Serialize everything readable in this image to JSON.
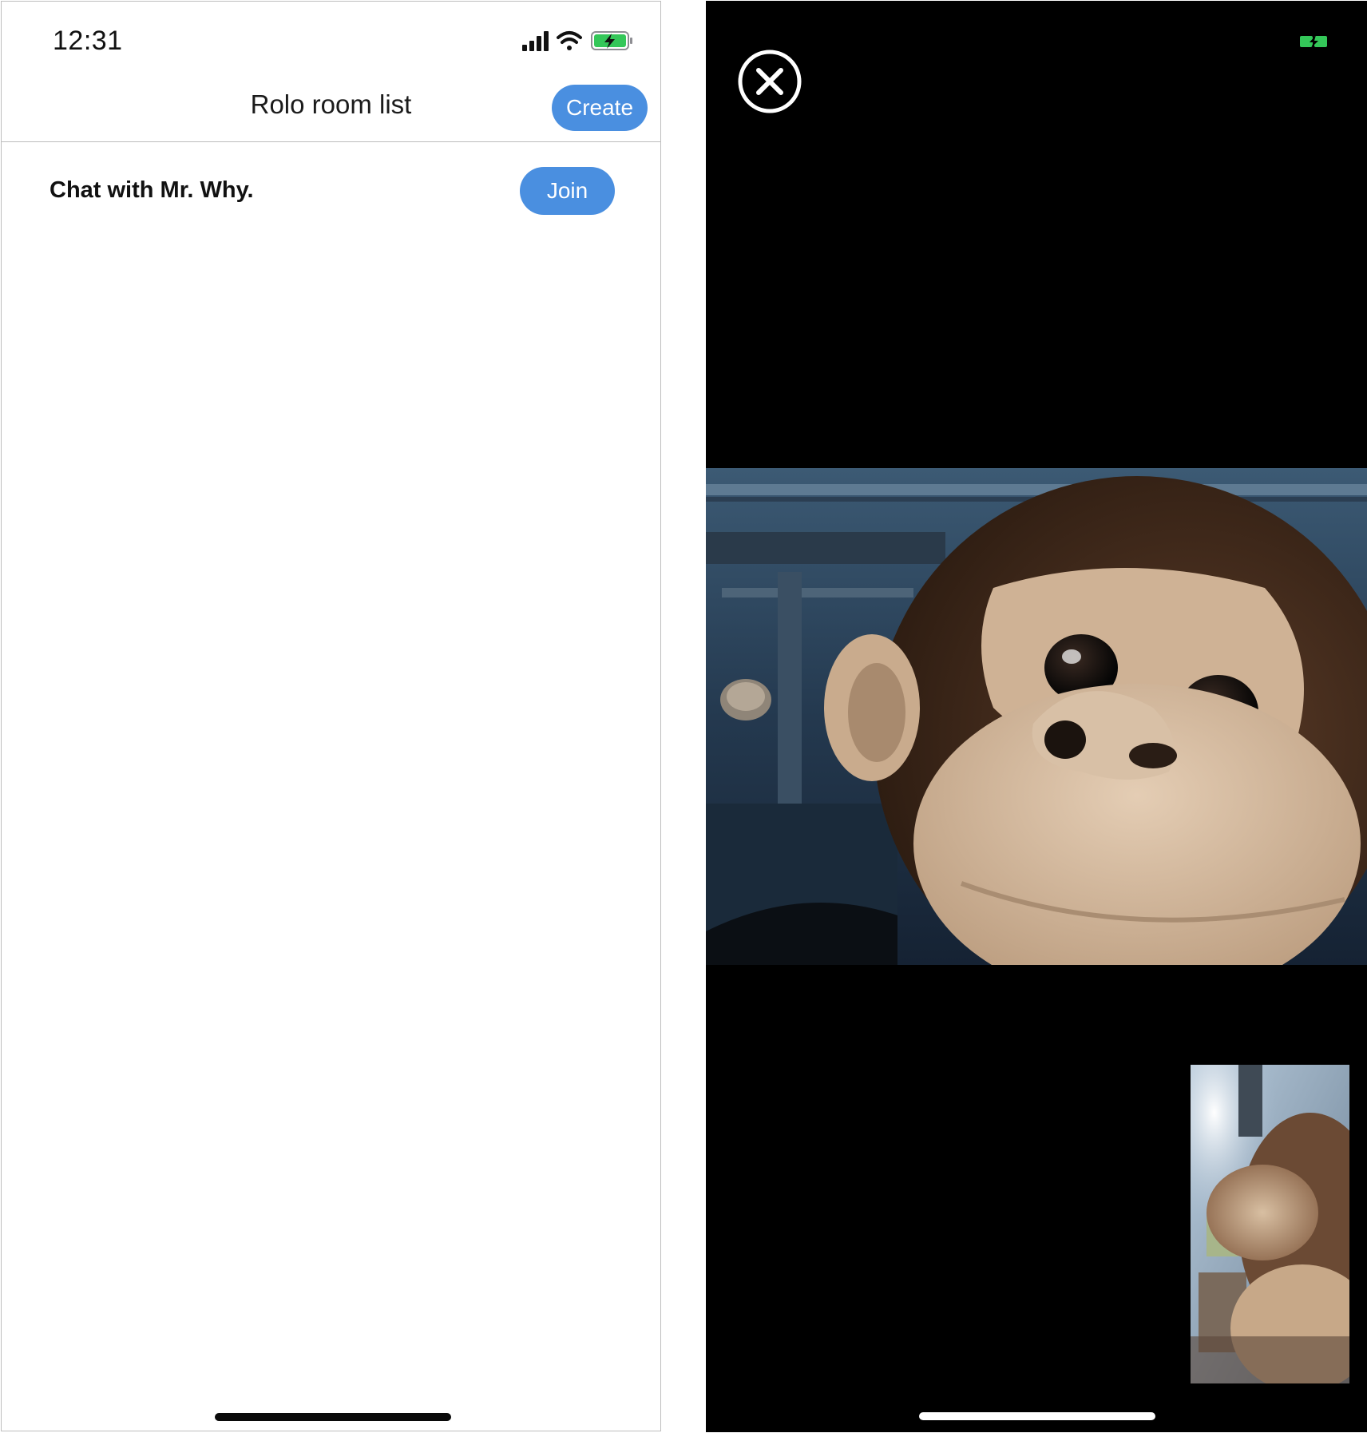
{
  "room_list_screen": {
    "status_bar": {
      "time": "12:31",
      "icons": [
        "cellular-signal-icon",
        "wifi-icon",
        "battery-charging-icon"
      ]
    },
    "nav": {
      "title": "Rolo room list",
      "create_label": "Create"
    },
    "rooms": [
      {
        "name": "Chat with Mr. Why.",
        "join_label": "Join"
      }
    ],
    "colors": {
      "accent": "#4a8fe0",
      "battery": "#34c759"
    }
  },
  "video_call_screen": {
    "close_icon": "close-circle-icon",
    "status_icons": [
      "battery-charging-icon"
    ],
    "remote_video": "plush-monkey-closeup",
    "self_view": "plush-monkey-selfie",
    "colors": {
      "background": "#000000",
      "battery": "#34c759"
    }
  }
}
